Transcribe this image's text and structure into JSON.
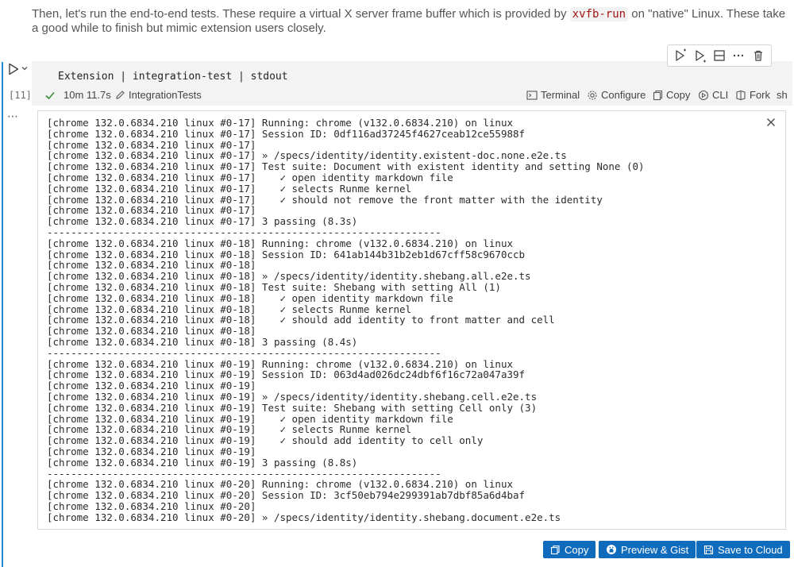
{
  "markdown": {
    "text_before": "Then, let's run the end-to-end tests. These require a virtual X server frame buffer which is provided by ",
    "code": "xvfb-run",
    "text_after": " on \"native\" Linux. These take a good while to finish but mimic extension users closely."
  },
  "cell": {
    "execution_count": "[11]",
    "code": "Extension | integration-test | stdout",
    "more": "⋯"
  },
  "status": {
    "duration": "10m 11.7s",
    "name": "IntegrationTests",
    "terminal": "Terminal",
    "configure": "Configure",
    "copy": "Copy",
    "cli": "CLI",
    "fork": "Fork",
    "lang": "sh"
  },
  "output": {
    "lines": [
      "[chrome 132.0.6834.210 linux #0-17] Running: chrome (v132.0.6834.210) on linux",
      "[chrome 132.0.6834.210 linux #0-17] Session ID: 0df116ad37245f4627ceab12ce55988f",
      "[chrome 132.0.6834.210 linux #0-17]",
      "[chrome 132.0.6834.210 linux #0-17] » /specs/identity/identity.existent-doc.none.e2e.ts",
      "[chrome 132.0.6834.210 linux #0-17] Test suite: Document with existent identity and setting None (0)",
      "[chrome 132.0.6834.210 linux #0-17]    ✓ open identity markdown file",
      "[chrome 132.0.6834.210 linux #0-17]    ✓ selects Runme kernel",
      "[chrome 132.0.6834.210 linux #0-17]    ✓ should not remove the front matter with the identity",
      "[chrome 132.0.6834.210 linux #0-17]",
      "[chrome 132.0.6834.210 linux #0-17] 3 passing (8.3s)",
      "------------------------------------------------------------------",
      "[chrome 132.0.6834.210 linux #0-18] Running: chrome (v132.0.6834.210) on linux",
      "[chrome 132.0.6834.210 linux #0-18] Session ID: 641ab144b31b2eb1d67cff58c9670ccb",
      "[chrome 132.0.6834.210 linux #0-18]",
      "[chrome 132.0.6834.210 linux #0-18] » /specs/identity/identity.shebang.all.e2e.ts",
      "[chrome 132.0.6834.210 linux #0-18] Test suite: Shebang with setting All (1)",
      "[chrome 132.0.6834.210 linux #0-18]    ✓ open identity markdown file",
      "[chrome 132.0.6834.210 linux #0-18]    ✓ selects Runme kernel",
      "[chrome 132.0.6834.210 linux #0-18]    ✓ should add identity to front matter and cell",
      "[chrome 132.0.6834.210 linux #0-18]",
      "[chrome 132.0.6834.210 linux #0-18] 3 passing (8.4s)",
      "------------------------------------------------------------------",
      "[chrome 132.0.6834.210 linux #0-19] Running: chrome (v132.0.6834.210) on linux",
      "[chrome 132.0.6834.210 linux #0-19] Session ID: 063d4ad026dc24dbf6f16c72a047a39f",
      "[chrome 132.0.6834.210 linux #0-19]",
      "[chrome 132.0.6834.210 linux #0-19] » /specs/identity/identity.shebang.cell.e2e.ts",
      "[chrome 132.0.6834.210 linux #0-19] Test suite: Shebang with setting Cell only (3)",
      "[chrome 132.0.6834.210 linux #0-19]    ✓ open identity markdown file",
      "[chrome 132.0.6834.210 linux #0-19]    ✓ selects Runme kernel",
      "[chrome 132.0.6834.210 linux #0-19]    ✓ should add identity to cell only",
      "[chrome 132.0.6834.210 linux #0-19]",
      "[chrome 132.0.6834.210 linux #0-19] 3 passing (8.8s)",
      "------------------------------------------------------------------",
      "[chrome 132.0.6834.210 linux #0-20] Running: chrome (v132.0.6834.210) on linux",
      "[chrome 132.0.6834.210 linux #0-20] Session ID: 3cf50eb794e299391ab7dbf85a6d4baf",
      "[chrome 132.0.6834.210 linux #0-20]",
      "[chrome 132.0.6834.210 linux #0-20] » /specs/identity/identity.shebang.document.e2e.ts"
    ]
  },
  "actions": {
    "copy": "Copy",
    "preview_gist": "Preview & Gist",
    "save_cloud": "Save to Cloud"
  },
  "colors": {
    "accent": "#0f6cbd",
    "focus": "#1e8bd6",
    "success": "#388a34",
    "inline_code": "#a31515"
  },
  "icons": {
    "run": "play-icon",
    "toolbar": [
      "run-above-icon",
      "run-below-icon",
      "split-cell-icon",
      "more-icon",
      "trash-icon"
    ],
    "close": "close-icon"
  }
}
